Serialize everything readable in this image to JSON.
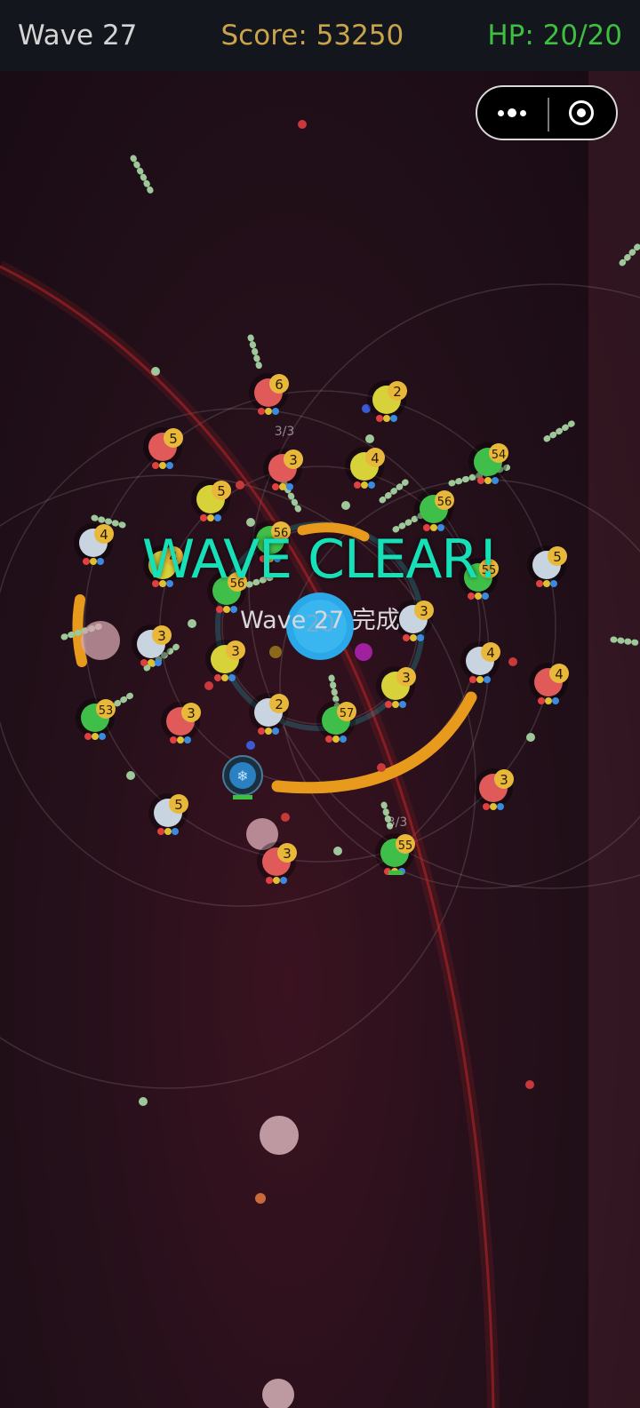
{
  "hud": {
    "wave": "Wave 27",
    "score": "Score: 53250",
    "hp": "HP: 20/20"
  },
  "banner": {
    "title": "WAVE CLEAR!",
    "subtitle": "Wave 27 完成"
  },
  "core": {
    "label": "20"
  },
  "menu_capsule": {
    "more_icon": "more-dots-icon",
    "close_icon": "target-ring-icon"
  },
  "colors": {
    "tower_red": "#e05a5a",
    "tower_yellow": "#d8d23a",
    "tower_green": "#3fbf4a",
    "tower_white": "#c8d4e0",
    "badge": "#e8b83a",
    "wave_clear": "#16e0b8",
    "orange_arc": "#e89a1c",
    "core_blue": "#2aa8e8"
  },
  "towers": [
    {
      "type": "red",
      "level": "6"
    },
    {
      "type": "yellow",
      "level": "2"
    },
    {
      "type": "red",
      "level": "5"
    },
    {
      "type": "red",
      "level": "3"
    },
    {
      "type": "yellow",
      "level": "4"
    },
    {
      "type": "green",
      "level": "54"
    },
    {
      "type": "yellow",
      "level": "5"
    },
    {
      "type": "green",
      "level": "56"
    },
    {
      "type": "white",
      "level": "4"
    },
    {
      "type": "yellow",
      "level": "4"
    },
    {
      "type": "green",
      "level": "56"
    },
    {
      "type": "green",
      "level": "56"
    },
    {
      "type": "green",
      "level": "55"
    },
    {
      "type": "white",
      "level": "5"
    },
    {
      "type": "white",
      "level": "3"
    },
    {
      "type": "yellow",
      "level": "3"
    },
    {
      "type": "white",
      "level": "3"
    },
    {
      "type": "white",
      "level": "4"
    },
    {
      "type": "red",
      "level": "4"
    },
    {
      "type": "green",
      "level": "53"
    },
    {
      "type": "red",
      "level": "3"
    },
    {
      "type": "white",
      "level": "2"
    },
    {
      "type": "green",
      "level": "57"
    },
    {
      "type": "yellow",
      "level": "3"
    },
    {
      "type": "white",
      "level": "5"
    },
    {
      "type": "red",
      "level": "3"
    },
    {
      "type": "red",
      "level": "3"
    },
    {
      "type": "green",
      "level": "55"
    }
  ],
  "counters": [
    "3/3",
    "3/3"
  ]
}
